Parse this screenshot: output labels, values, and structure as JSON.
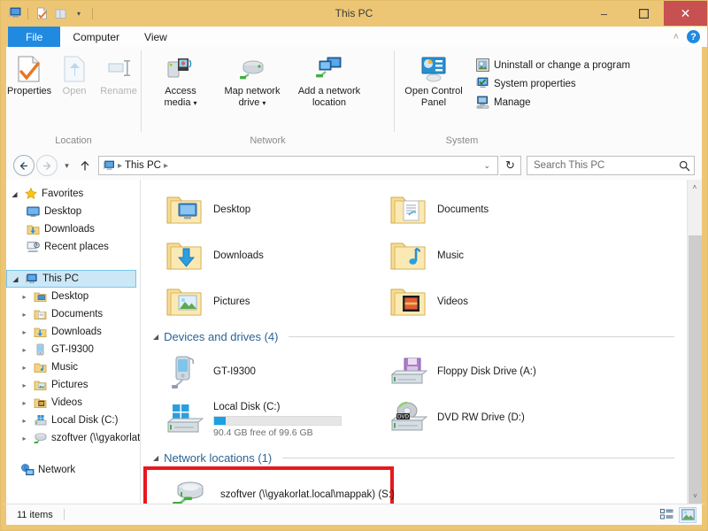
{
  "window": {
    "title": "This PC",
    "minimize_label": "–",
    "maximize_label": "❐",
    "close_label": "✕"
  },
  "quick_access": {
    "items": [
      {
        "name": "this-pc-icon",
        "label": ""
      },
      {
        "name": "properties-icon",
        "label": ""
      },
      {
        "name": "new-folder-icon",
        "label": ""
      },
      {
        "name": "customize-dropdown-icon",
        "label": "▾"
      }
    ]
  },
  "tabs": [
    {
      "label": "File",
      "state": "file-menu"
    },
    {
      "label": "Computer",
      "state": "active"
    },
    {
      "label": "View",
      "state": "inactive"
    }
  ],
  "ribbon_controls": {
    "collapse_label": "˄",
    "help_label": "?"
  },
  "ribbon": {
    "groups": [
      {
        "label": "Location",
        "buttons": [
          {
            "label": "Properties",
            "icon": "properties-icon",
            "enabled": true
          },
          {
            "label": "Open",
            "icon": "open-icon",
            "enabled": false
          },
          {
            "label": "Rename",
            "icon": "rename-icon",
            "enabled": false
          }
        ]
      },
      {
        "label": "Network",
        "buttons": [
          {
            "label": "Access media",
            "icon": "access-media-icon",
            "enabled": true,
            "dropdown": true
          },
          {
            "label": "Map network drive",
            "icon": "map-network-drive-icon",
            "enabled": true,
            "dropdown": true
          },
          {
            "label": "Add a network location",
            "icon": "add-network-location-icon",
            "enabled": true,
            "dropdown": false
          }
        ]
      },
      {
        "label": "System",
        "buttons": [
          {
            "label": "Open Control Panel",
            "icon": "control-panel-icon",
            "enabled": true
          }
        ],
        "small_buttons": [
          {
            "label": "Uninstall or change a program",
            "icon": "uninstall-program-icon"
          },
          {
            "label": "System properties",
            "icon": "system-properties-icon"
          },
          {
            "label": "Manage",
            "icon": "manage-icon"
          }
        ]
      }
    ]
  },
  "address_bar": {
    "back_label": "←",
    "forward_label": "→",
    "recent_label": "▾",
    "up_label": "↑",
    "crumbs": [
      "This PC"
    ],
    "crumb_separator": "▸",
    "dropdown_label": "⌄",
    "refresh_label": "↻",
    "search_placeholder": "Search This PC",
    "search_value": "",
    "search_icon": "search-icon"
  },
  "nav_pane": {
    "items": [
      {
        "label": "Favorites",
        "icon": "star-icon",
        "indent": 0,
        "expander": "open",
        "selected": false
      },
      {
        "label": "Desktop",
        "icon": "desktop-icon",
        "indent": 1,
        "expander": "none",
        "selected": false
      },
      {
        "label": "Downloads",
        "icon": "downloads-icon",
        "indent": 1,
        "expander": "none",
        "selected": false
      },
      {
        "label": "Recent places",
        "icon": "recent-places-icon",
        "indent": 1,
        "expander": "none",
        "selected": false
      },
      {
        "label": "",
        "icon": "",
        "indent": 0,
        "expander": "none",
        "selected": false,
        "spacer": true
      },
      {
        "label": "This PC",
        "icon": "this-pc-icon",
        "indent": 0,
        "expander": "open",
        "selected": true
      },
      {
        "label": "Desktop",
        "icon": "folder-desktop-icon",
        "indent": 1,
        "expander": "closed",
        "selected": false
      },
      {
        "label": "Documents",
        "icon": "folder-documents-icon",
        "indent": 1,
        "expander": "closed",
        "selected": false
      },
      {
        "label": "Downloads",
        "icon": "folder-downloads-icon",
        "indent": 1,
        "expander": "closed",
        "selected": false
      },
      {
        "label": "GT-I9300",
        "icon": "phone-icon",
        "indent": 1,
        "expander": "closed",
        "selected": false
      },
      {
        "label": "Music",
        "icon": "folder-music-icon",
        "indent": 1,
        "expander": "closed",
        "selected": false
      },
      {
        "label": "Pictures",
        "icon": "folder-pictures-icon",
        "indent": 1,
        "expander": "closed",
        "selected": false
      },
      {
        "label": "Videos",
        "icon": "folder-videos-icon",
        "indent": 1,
        "expander": "closed",
        "selected": false
      },
      {
        "label": "Local Disk (C:)",
        "icon": "local-disk-icon",
        "indent": 1,
        "expander": "closed",
        "selected": false
      },
      {
        "label": "szoftver (\\\\gyakorlat",
        "icon": "network-drive-icon",
        "indent": 1,
        "expander": "closed",
        "selected": false
      },
      {
        "label": "",
        "icon": "",
        "indent": 0,
        "expander": "none",
        "selected": false,
        "spacer": true
      },
      {
        "label": "Network",
        "icon": "network-icon",
        "indent": 0,
        "expander": "none",
        "selected": false
      }
    ]
  },
  "content": {
    "sections": [
      {
        "header": "",
        "has_header": false,
        "items": [
          {
            "label": "Desktop",
            "icon": "folder-desktop-icon"
          },
          {
            "label": "Documents",
            "icon": "folder-documents-icon"
          },
          {
            "label": "Downloads",
            "icon": "folder-downloads-icon"
          },
          {
            "label": "Music",
            "icon": "folder-music-icon"
          },
          {
            "label": "Pictures",
            "icon": "folder-pictures-icon"
          },
          {
            "label": "Videos",
            "icon": "folder-videos-icon"
          }
        ]
      },
      {
        "header": "Devices and drives (4)",
        "has_header": true,
        "items": [
          {
            "label": "GT-I9300",
            "icon": "phone-icon"
          },
          {
            "label": "Floppy Disk Drive (A:)",
            "icon": "floppy-drive-icon"
          },
          {
            "label": "Local Disk (C:)",
            "icon": "local-disk-icon",
            "capacity_text": "90.4 GB free of 99.6 GB",
            "used_percent": 9
          },
          {
            "label": "DVD RW Drive (D:)",
            "icon": "dvd-drive-icon"
          }
        ]
      },
      {
        "header": "Network locations (1)",
        "has_header": true,
        "items": [
          {
            "label": "szoftver (\\\\gyakorlat.local\\mappak) (S:)",
            "icon": "network-drive-icon",
            "highlighted": true
          }
        ]
      }
    ],
    "collapse_triangle": "▴"
  },
  "status_bar": {
    "item_count": "11 items",
    "view_buttons": [
      {
        "name": "details-view-button",
        "label": "",
        "active": false
      },
      {
        "name": "large-icons-view-button",
        "label": "",
        "active": true
      }
    ]
  },
  "colors": {
    "title_bar": "#edc675",
    "file_tab": "#1f8ae0",
    "close_button": "#c75050",
    "selection": "#cce8f6",
    "selection_border": "#76c4e8",
    "section_header": "#2a6496",
    "highlight_box": "#e8181c",
    "progress_fill": "#1ba1e2",
    "scrollbar_thumb": "#cdcdcd"
  },
  "scrollbar": {
    "up_label": "˄",
    "down_label": "˅"
  }
}
